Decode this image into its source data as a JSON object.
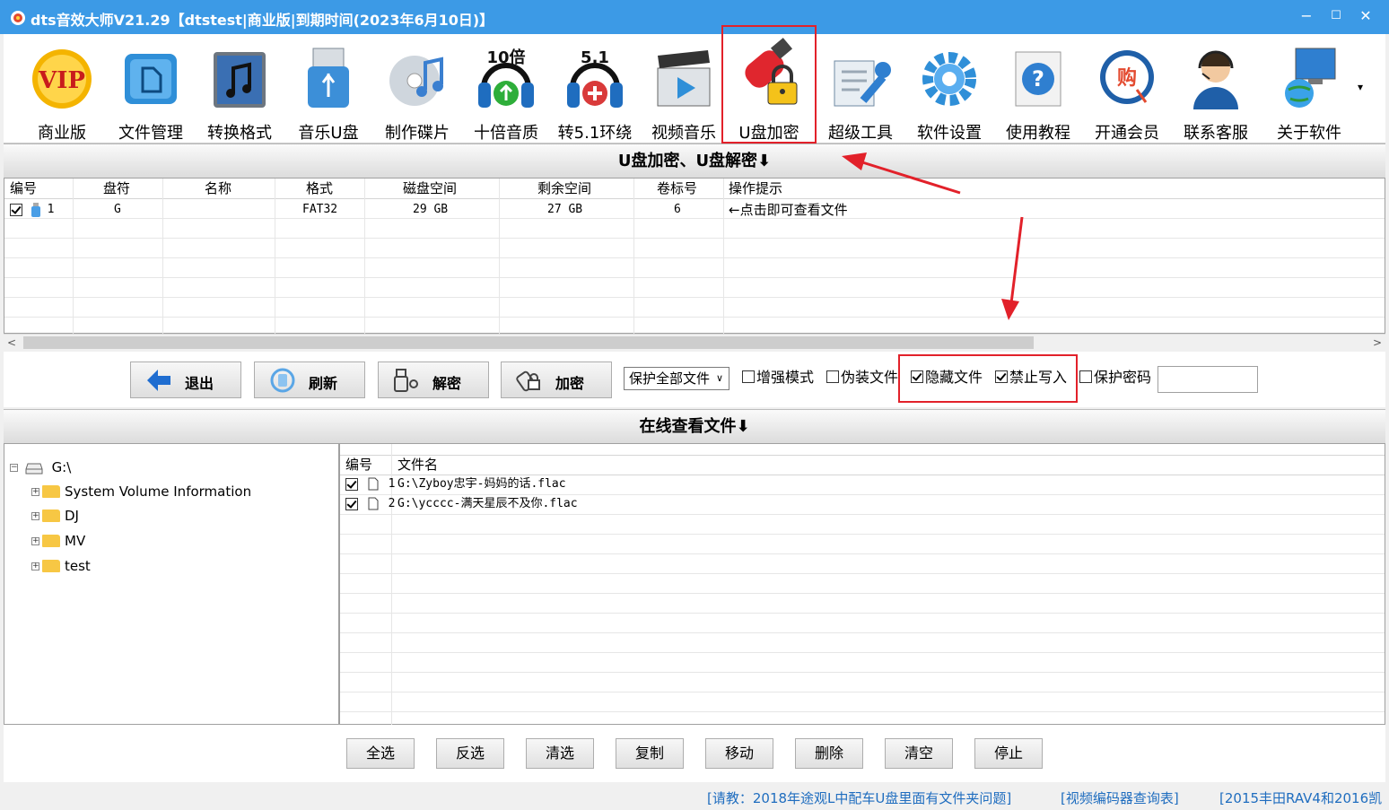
{
  "window": {
    "title": "dts音效大师V21.29【dtstest|商业版|到期时间(2023年6月10日)】",
    "min": "−",
    "max": "☐",
    "close": "✕"
  },
  "toolbar": {
    "items": [
      {
        "label": "商业版",
        "icon": "vip-icon"
      },
      {
        "label": "文件管理",
        "icon": "folder-icon"
      },
      {
        "label": "转换格式",
        "icon": "music-note-icon"
      },
      {
        "label": "音乐U盘",
        "icon": "usb-icon"
      },
      {
        "label": "制作碟片",
        "icon": "disc-icon"
      },
      {
        "label": "十倍音质",
        "icon": "headphones-10x-icon"
      },
      {
        "label": "转5.1环绕",
        "icon": "headphones-51-icon"
      },
      {
        "label": "视频音乐",
        "icon": "clapperboard-icon"
      },
      {
        "label": "U盘加密",
        "icon": "usb-lock-icon"
      },
      {
        "label": "超级工具",
        "icon": "wrench-icon"
      },
      {
        "label": "软件设置",
        "icon": "gear-icon"
      },
      {
        "label": "使用教程",
        "icon": "help-book-icon"
      },
      {
        "label": "开通会员",
        "icon": "shop-cart-icon"
      },
      {
        "label": "联系客服",
        "icon": "support-agent-icon"
      },
      {
        "label": "关于软件",
        "icon": "computer-globe-icon"
      }
    ],
    "icon_10x_text": "10倍",
    "icon_51_text": "5.1",
    "icon_vip_text": "VIP",
    "icon_shop_text": "购",
    "more": "▾"
  },
  "drive_section": {
    "title": "U盘加密、U盘解密⬇",
    "columns": [
      "编号",
      "盘符",
      "名称",
      "格式",
      "磁盘空间",
      "剩余空间",
      "卷标号",
      "操作提示"
    ],
    "rows": [
      {
        "checked": true,
        "num": "1",
        "drive": "G",
        "name": "",
        "format": "FAT32",
        "size": "29 GB",
        "free": "27 GB",
        "label": "6",
        "hint": "←点击即可查看文件"
      }
    ]
  },
  "actions": {
    "exit": "退出",
    "refresh": "刷新",
    "decrypt": "解密",
    "encrypt": "加密",
    "protect_select": "保护全部文件",
    "options": [
      {
        "label": "增强模式",
        "checked": false
      },
      {
        "label": "伪装文件",
        "checked": false
      },
      {
        "label": "隐藏文件",
        "checked": true
      },
      {
        "label": "禁止写入",
        "checked": true
      },
      {
        "label": "保护密码",
        "checked": false
      }
    ],
    "password": ""
  },
  "online_section": {
    "title": "在线查看文件⬇",
    "tree": {
      "root": "G:\\",
      "children": [
        "System Volume Information",
        "DJ",
        "MV",
        "test"
      ]
    },
    "files": {
      "columns": [
        "编号",
        "文件名"
      ],
      "rows": [
        {
          "checked": true,
          "num": "1",
          "name": "G:\\Zyboy忠宇-妈妈的话.flac"
        },
        {
          "checked": true,
          "num": "2",
          "name": "G:\\ycccc-满天星辰不及你.flac"
        }
      ]
    }
  },
  "bottom_buttons": [
    "全选",
    "反选",
    "清选",
    "复制",
    "移动",
    "删除",
    "清空",
    "停止"
  ],
  "status_links": [
    "[请教：2018年途观L中配车U盘里面有文件夹问题]",
    "[视频编码器查询表]",
    "[2015丰田RAV4和2016凯"
  ],
  "colors": {
    "titlebar": "#3c9ae6",
    "highlight": "#e2212a",
    "link": "#1f6dbf"
  }
}
